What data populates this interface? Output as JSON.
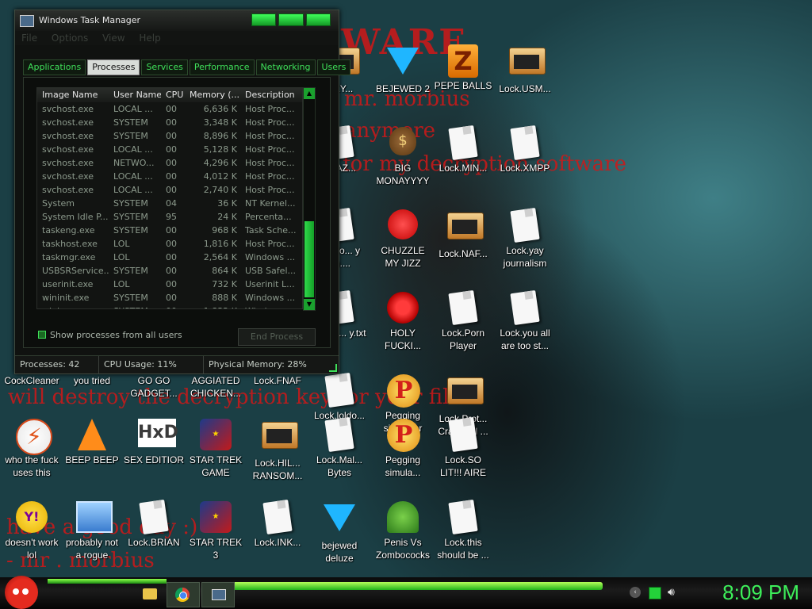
{
  "wallpaper_text": {
    "big": "WARE",
    "line1": "for my decryption software",
    "line2": "mr. morbius",
    "line3": "anymore",
    "line4": "will destroy the decryption key for your files",
    "line5": "have a good day :)",
    "line6": "- mr . morbius"
  },
  "desktop_icons": [
    {
      "label": "...KY...",
      "type": "win"
    },
    {
      "label": "BEJEWED 2",
      "type": "gem"
    },
    {
      "label": "PEPE BALLS",
      "type": "zbadge"
    },
    {
      "label": "Lock.USM...",
      "type": "win"
    },
    {
      "label": "...LAZ...",
      "type": "doc"
    },
    {
      "label": "BIG MONAYYYY",
      "type": "moneybag"
    },
    {
      "label": "Lock.MIN...",
      "type": "doc"
    },
    {
      "label": "Lock.XMPP",
      "type": "doc"
    },
    {
      "label": "...oldo... y (2)....",
      "type": "doc"
    },
    {
      "label": "CHUZZLE MY JIZZ",
      "type": "fuzz"
    },
    {
      "label": "Lock.NAF...",
      "type": "win"
    },
    {
      "label": "Lock.yay journalism",
      "type": "doc"
    },
    {
      "label": "...oldo... y.txt",
      "type": "doc"
    },
    {
      "label": "HOLY FUCKI...",
      "type": "redring"
    },
    {
      "label": "Lock.Porn Player",
      "type": "doc"
    },
    {
      "label": "Lock.you all are too st...",
      "type": "doc"
    },
    {
      "label": "CockCleaner",
      "type": "none"
    },
    {
      "label": "you tried",
      "type": "none"
    },
    {
      "label": "GO GO GADGET...",
      "type": "none"
    },
    {
      "label": "AGGIATED CHICKEN...",
      "type": "none"
    },
    {
      "label": "Lock.FNAF",
      "type": "none"
    },
    {
      "label": "Lock.loldo...",
      "type": "doc"
    },
    {
      "label": "Pegging simulator",
      "type": "pbadge"
    },
    {
      "label": "Lock.Prot... Crack full ...",
      "type": "win"
    },
    {
      "label": "who the fuck uses this",
      "type": "flash"
    },
    {
      "label": "BEEP BEEP",
      "type": "cone"
    },
    {
      "label": "SEX EDITIOR",
      "type": "hxd"
    },
    {
      "label": "STAR TREK GAME",
      "type": "starwars"
    },
    {
      "label": "Lock.HIL... RANSOM...",
      "type": "win"
    },
    {
      "label": "Lock.Mal... Bytes",
      "type": "doc"
    },
    {
      "label": "Pegging simula...",
      "type": "pbadge"
    },
    {
      "label": "Lock.SO LIT!!! AIRE",
      "type": "doc"
    },
    {
      "label": "doesn't work lol",
      "type": "yahoo"
    },
    {
      "label": "probably not a rogue",
      "type": "gadget"
    },
    {
      "label": "Lock.BRIAN",
      "type": "doc"
    },
    {
      "label": "STAR TREK 3",
      "type": "starwars"
    },
    {
      "label": "Lock.INK...",
      "type": "doc"
    },
    {
      "label": "bejewed deluze",
      "type": "gem"
    },
    {
      "label": "Penis Vs Zombococks",
      "type": "plant"
    },
    {
      "label": "Lock.this should be ...",
      "type": "doc"
    }
  ],
  "taskmgr": {
    "title": "Windows Task Manager",
    "menu": [
      "File",
      "Options",
      "View",
      "Help"
    ],
    "tabs": [
      "Applications",
      "Processes",
      "Services",
      "Performance",
      "Networking",
      "Users"
    ],
    "active_tab": "Processes",
    "columns": [
      "Image Name",
      "User Name",
      "CPU",
      "Memory (...",
      "Description"
    ],
    "rows": [
      [
        "svchost.exe",
        "LOCAL ...",
        "00",
        "6,636 K",
        "Host Proc..."
      ],
      [
        "svchost.exe",
        "SYSTEM",
        "00",
        "3,348 K",
        "Host Proc..."
      ],
      [
        "svchost.exe",
        "SYSTEM",
        "00",
        "8,896 K",
        "Host Proc..."
      ],
      [
        "svchost.exe",
        "LOCAL ...",
        "00",
        "5,128 K",
        "Host Proc..."
      ],
      [
        "svchost.exe",
        "NETWO...",
        "00",
        "4,296 K",
        "Host Proc..."
      ],
      [
        "svchost.exe",
        "LOCAL ...",
        "00",
        "4,012 K",
        "Host Proc..."
      ],
      [
        "svchost.exe",
        "LOCAL ...",
        "00",
        "2,740 K",
        "Host Proc..."
      ],
      [
        "System",
        "SYSTEM",
        "04",
        "36 K",
        "NT Kernel..."
      ],
      [
        "System Idle P...",
        "SYSTEM",
        "95",
        "24 K",
        "Percenta..."
      ],
      [
        "taskeng.exe",
        "SYSTEM",
        "00",
        "968 K",
        "Task Sche..."
      ],
      [
        "taskhost.exe",
        "LOL",
        "00",
        "1,816 K",
        "Host Proc..."
      ],
      [
        "taskmgr.exe",
        "LOL",
        "00",
        "2,564 K",
        "Windows ..."
      ],
      [
        "USBSRService...",
        "SYSTEM",
        "00",
        "864 K",
        "USB Safel..."
      ],
      [
        "userinit.exe",
        "LOL",
        "00",
        "732 K",
        "Userinit L..."
      ],
      [
        "wininit.exe",
        "SYSTEM",
        "00",
        "888 K",
        "Windows ..."
      ],
      [
        "winlogon.exe",
        "SYSTEM",
        "00",
        "1,832 K",
        "Windows ..."
      ]
    ],
    "show_all_label": "Show processes from all users",
    "end_process_label": "End Process",
    "status": {
      "processes": "Processes: 42",
      "cpu": "CPU Usage: 11%",
      "memory": "Physical Memory: 28%"
    }
  },
  "taskbar": {
    "clock": "8:09 PM"
  }
}
